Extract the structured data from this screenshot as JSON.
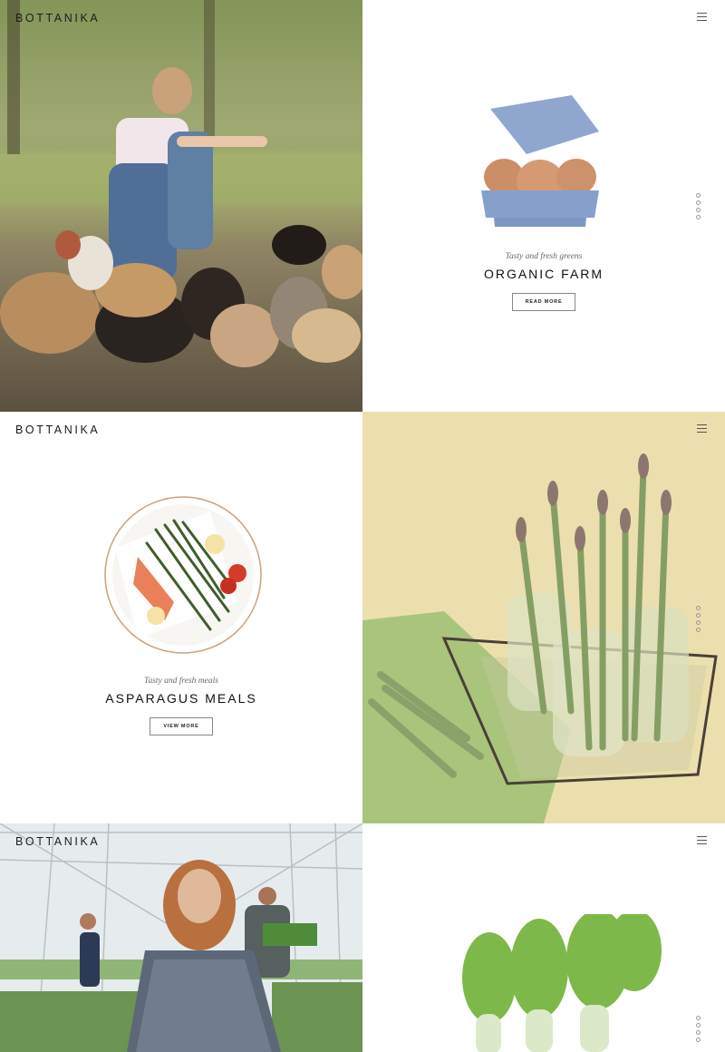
{
  "brand": {
    "logo_text": "BOTTANIKA"
  },
  "panels": {
    "organic_farm": {
      "tagline": "Tasty and fresh greens",
      "title": "ORGANIC FARM",
      "button_label": "READ MORE"
    },
    "asparagus_meals": {
      "tagline": "Tasty and fresh meals",
      "title": "ASPARAGUS MEALS",
      "button_label": "VIEW MORE"
    }
  },
  "icons": {
    "menu": "hamburger-menu-icon",
    "pagination": "pagination-dots-icon"
  },
  "colors": {
    "background": "#ffffff",
    "text": "#111111",
    "accent_border": "#888888"
  }
}
